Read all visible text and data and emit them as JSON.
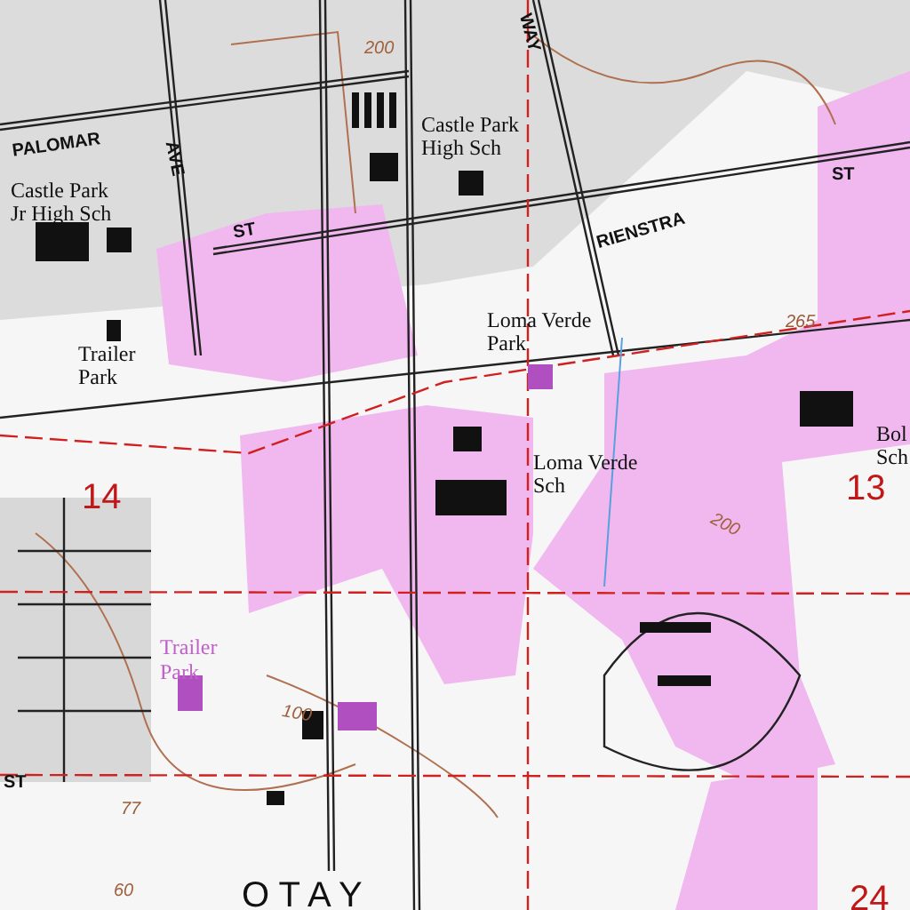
{
  "map": {
    "labels": [
      {
        "lines": [
          "PALOMAR"
        ],
        "kind": "street"
      },
      {
        "lines": [
          "AVE"
        ],
        "kind": "street"
      },
      {
        "lines": [
          "ST"
        ],
        "kind": "street"
      },
      {
        "lines": [
          "WAY"
        ],
        "kind": "street"
      },
      {
        "lines": [
          "ST"
        ],
        "kind": "street"
      },
      {
        "lines": [
          "RIENSTRA"
        ],
        "kind": "street"
      },
      {
        "lines": [
          "Castle Park",
          "High Sch"
        ],
        "kind": "feature"
      },
      {
        "lines": [
          "Castle Park",
          "Jr High Sch"
        ],
        "kind": "feature"
      },
      {
        "lines": [
          "Trailer",
          "Park"
        ],
        "kind": "feature"
      },
      {
        "lines": [
          "Loma Verde",
          "Park"
        ],
        "kind": "feature"
      },
      {
        "lines": [
          "Loma Verde",
          "Sch"
        ],
        "kind": "feature"
      },
      {
        "lines": [
          "Bol",
          "Sch"
        ],
        "kind": "feature"
      },
      {
        "lines": [
          "Trailer",
          "Park"
        ],
        "kind": "tinted"
      },
      {
        "lines": [
          "14"
        ],
        "kind": "section"
      },
      {
        "lines": [
          "13"
        ],
        "kind": "section"
      },
      {
        "lines": [
          "24"
        ],
        "kind": "section"
      },
      {
        "lines": [
          "265"
        ],
        "kind": "elevation"
      },
      {
        "lines": [
          "200"
        ],
        "kind": "contour"
      },
      {
        "lines": [
          "200"
        ],
        "kind": "contour"
      },
      {
        "lines": [
          "100"
        ],
        "kind": "contour"
      },
      {
        "lines": [
          "77"
        ],
        "kind": "elevation"
      },
      {
        "lines": [
          "60"
        ],
        "kind": "contour"
      },
      {
        "lines": [
          "ST"
        ],
        "kind": "street"
      },
      {
        "lines": [
          "O T A Y"
        ],
        "kind": "town"
      }
    ]
  }
}
